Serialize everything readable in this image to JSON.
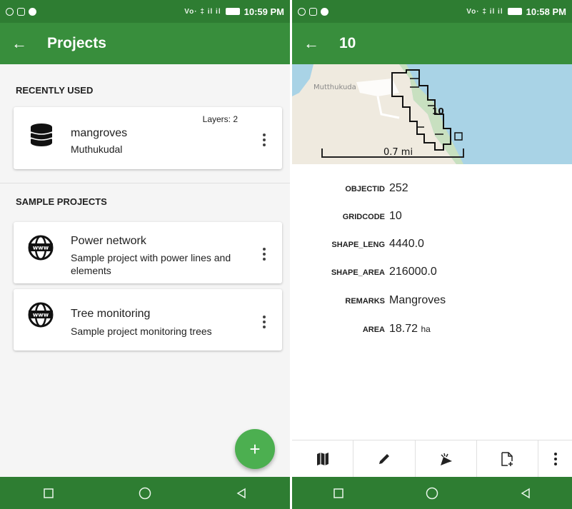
{
  "left": {
    "status": {
      "time": "10:59 PM",
      "signal": "Vo· ‡ il il"
    },
    "appbar": {
      "title": "Projects"
    },
    "recent_header": "RECENTLY USED",
    "recent": [
      {
        "name": "mangroves",
        "desc": "Muthukudal",
        "layers": "Layers: 2",
        "icon": "database-icon"
      }
    ],
    "sample_header": "SAMPLE PROJECTS",
    "samples": [
      {
        "name": "Power network",
        "desc": "Sample project with power lines and elements",
        "icon": "globe-www-icon"
      },
      {
        "name": "Tree monitoring",
        "desc": "Sample project monitoring trees",
        "icon": "globe-www-icon"
      }
    ],
    "fab_label": "+"
  },
  "right": {
    "status": {
      "time": "10:58 PM",
      "signal": "Vo· ‡ il il"
    },
    "appbar": {
      "title": "10"
    },
    "map": {
      "place_label": "Mutthukuda",
      "feature_label": "10",
      "scale_label": "0.7 mi"
    },
    "attributes": [
      {
        "key": "OBJECTID",
        "value": "252",
        "unit": ""
      },
      {
        "key": "GRIDCODE",
        "value": "10",
        "unit": ""
      },
      {
        "key": "SHAPE_LENG",
        "value": "4440.0",
        "unit": ""
      },
      {
        "key": "SHAPE_AREA",
        "value": "216000.0",
        "unit": ""
      },
      {
        "key": "REMARKS",
        "value": "Mangroves",
        "unit": ""
      },
      {
        "key": "AREA",
        "value": "18.72",
        "unit": "ha"
      }
    ],
    "toolbar": [
      "map-icon",
      "pencil-icon",
      "move-feature-icon",
      "new-file-icon",
      "more-vert-icon"
    ]
  },
  "colors": {
    "statusbar": "#2e7d32",
    "appbar": "#388e3c",
    "fab": "#4caf50",
    "navbar": "#2e7d32"
  }
}
